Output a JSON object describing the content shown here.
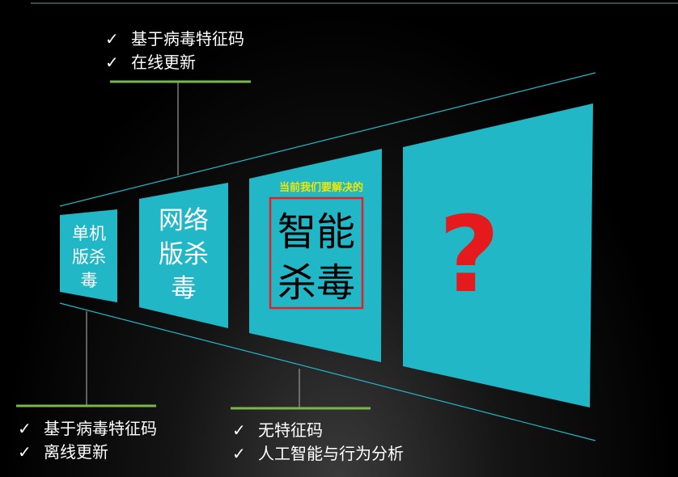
{
  "top_list": {
    "items": [
      "基于病毒特征码",
      "在线更新"
    ]
  },
  "left_list": {
    "items": [
      "基于病毒特征码",
      "离线更新"
    ]
  },
  "right_list": {
    "items": [
      "无特征码",
      "人工智能与行为分析"
    ]
  },
  "check_mark": "✓",
  "panels": [
    {
      "lines": [
        "单机",
        "版杀",
        "毒"
      ]
    },
    {
      "lines": [
        "网络",
        "版杀",
        "毒"
      ]
    },
    {
      "lines": [
        "智能",
        "杀毒"
      ],
      "caption": "当前我们要解决的"
    },
    {
      "symbol": "?"
    }
  ],
  "colors": {
    "panel": "#22b7c6",
    "accent_line": "#7ab648",
    "question": "#e41a1c",
    "caption": "#f2e600",
    "highlight_box": "#e32028"
  }
}
